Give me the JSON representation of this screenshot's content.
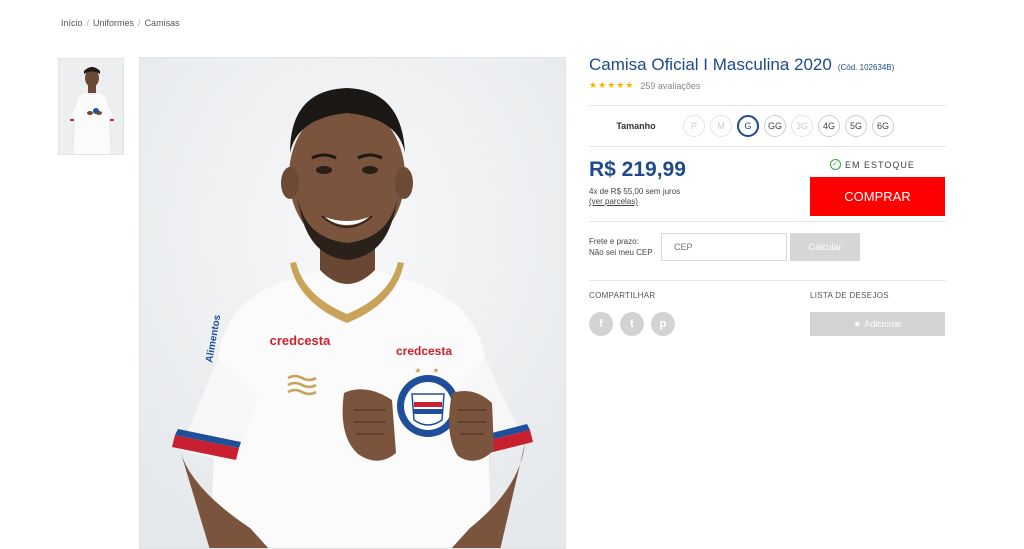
{
  "breadcrumb": [
    {
      "label": "Início"
    },
    {
      "label": "Uniformes"
    },
    {
      "label": "Camisas"
    }
  ],
  "breadcrumb_separator": "/",
  "product": {
    "title": "Camisa Oficial I Masculina 2020",
    "code": "(Cód. 102634B)",
    "stars": "★★★★★",
    "reviews": "259 avaliações",
    "shirt_sponsor_left": "credcesta",
    "shirt_sponsor_right": "credcesta",
    "sleeve_text": "Alimentos"
  },
  "sizes": {
    "label": "Tamanho",
    "options": [
      {
        "label": "P",
        "available": false
      },
      {
        "label": "M",
        "available": false
      },
      {
        "label": "G",
        "available": true,
        "selected": true
      },
      {
        "label": "GG",
        "available": true
      },
      {
        "label": "3G",
        "available": false
      },
      {
        "label": "4G",
        "available": true
      },
      {
        "label": "5G",
        "available": true
      },
      {
        "label": "6G",
        "available": true
      }
    ]
  },
  "pricing": {
    "price": "R$ 219,99",
    "installments": "4x de R$ 55,00 sem juros",
    "see_installments": "(ver parcelas)",
    "stock": "EM ESTOQUE",
    "buy_label": "COMPRAR"
  },
  "freight": {
    "label_line1": "Frete e prazo:",
    "label_line2": "Não sei meu CEP",
    "cep_placeholder": "CEP",
    "calc_label": "Calcular"
  },
  "share": {
    "label": "COMPARTILHAR",
    "networks": [
      "f",
      "t",
      "p"
    ]
  },
  "wishlist": {
    "label": "LISTA DE DESEJOS",
    "add_label": "Adicionar"
  },
  "colors": {
    "brand_blue": "#1e4a8a",
    "buy_red": "#ff0000",
    "star_yellow": "#f5b400",
    "stock_green": "#3aa34a"
  },
  "icons": {
    "stock": "check-circle-icon",
    "share": [
      "facebook-icon",
      "twitter-icon",
      "pinterest-icon"
    ],
    "wishlist": "star-icon"
  }
}
